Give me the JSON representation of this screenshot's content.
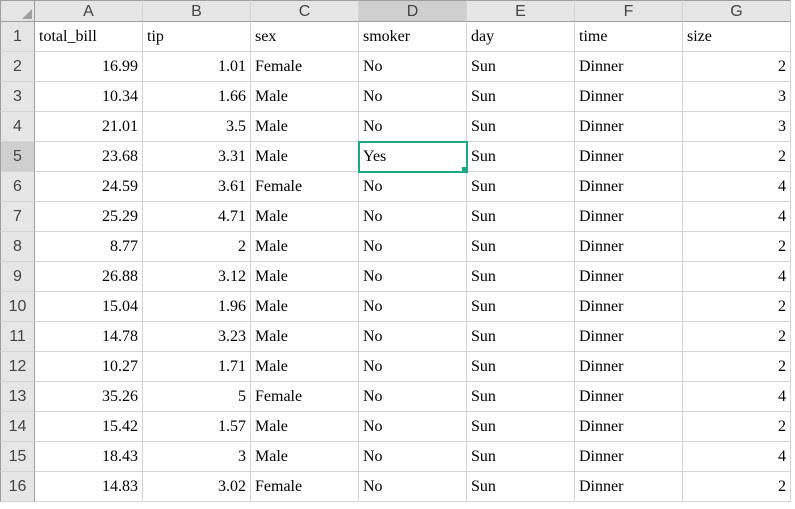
{
  "columns": [
    "A",
    "B",
    "C",
    "D",
    "E",
    "F",
    "G"
  ],
  "selected_col_index": 3,
  "selected_row_index": 4,
  "active_cell": {
    "row": 4,
    "col": 3
  },
  "headers": [
    "total_bill",
    "tip",
    "sex",
    "smoker",
    "day",
    "time",
    "size"
  ],
  "rows": [
    {
      "total_bill": "16.99",
      "tip": "1.01",
      "sex": "Female",
      "smoker": "No",
      "day": "Sun",
      "time": "Dinner",
      "size": "2"
    },
    {
      "total_bill": "10.34",
      "tip": "1.66",
      "sex": "Male",
      "smoker": "No",
      "day": "Sun",
      "time": "Dinner",
      "size": "3"
    },
    {
      "total_bill": "21.01",
      "tip": "3.5",
      "sex": "Male",
      "smoker": "No",
      "day": "Sun",
      "time": "Dinner",
      "size": "3"
    },
    {
      "total_bill": "23.68",
      "tip": "3.31",
      "sex": "Male",
      "smoker": "Yes",
      "day": "Sun",
      "time": "Dinner",
      "size": "2"
    },
    {
      "total_bill": "24.59",
      "tip": "3.61",
      "sex": "Female",
      "smoker": "No",
      "day": "Sun",
      "time": "Dinner",
      "size": "4"
    },
    {
      "total_bill": "25.29",
      "tip": "4.71",
      "sex": "Male",
      "smoker": "No",
      "day": "Sun",
      "time": "Dinner",
      "size": "4"
    },
    {
      "total_bill": "8.77",
      "tip": "2",
      "sex": "Male",
      "smoker": "No",
      "day": "Sun",
      "time": "Dinner",
      "size": "2"
    },
    {
      "total_bill": "26.88",
      "tip": "3.12",
      "sex": "Male",
      "smoker": "No",
      "day": "Sun",
      "time": "Dinner",
      "size": "4"
    },
    {
      "total_bill": "15.04",
      "tip": "1.96",
      "sex": "Male",
      "smoker": "No",
      "day": "Sun",
      "time": "Dinner",
      "size": "2"
    },
    {
      "total_bill": "14.78",
      "tip": "3.23",
      "sex": "Male",
      "smoker": "No",
      "day": "Sun",
      "time": "Dinner",
      "size": "2"
    },
    {
      "total_bill": "10.27",
      "tip": "1.71",
      "sex": "Male",
      "smoker": "No",
      "day": "Sun",
      "time": "Dinner",
      "size": "2"
    },
    {
      "total_bill": "35.26",
      "tip": "5",
      "sex": "Female",
      "smoker": "No",
      "day": "Sun",
      "time": "Dinner",
      "size": "4"
    },
    {
      "total_bill": "15.42",
      "tip": "1.57",
      "sex": "Male",
      "smoker": "No",
      "day": "Sun",
      "time": "Dinner",
      "size": "2"
    },
    {
      "total_bill": "18.43",
      "tip": "3",
      "sex": "Male",
      "smoker": "No",
      "day": "Sun",
      "time": "Dinner",
      "size": "4"
    },
    {
      "total_bill": "14.83",
      "tip": "3.02",
      "sex": "Female",
      "smoker": "No",
      "day": "Sun",
      "time": "Dinner",
      "size": "2"
    }
  ],
  "chart_data": {
    "type": "table",
    "columns": [
      "total_bill",
      "tip",
      "sex",
      "smoker",
      "day",
      "time",
      "size"
    ],
    "data": [
      [
        16.99,
        1.01,
        "Female",
        "No",
        "Sun",
        "Dinner",
        2
      ],
      [
        10.34,
        1.66,
        "Male",
        "No",
        "Sun",
        "Dinner",
        3
      ],
      [
        21.01,
        3.5,
        "Male",
        "No",
        "Sun",
        "Dinner",
        3
      ],
      [
        23.68,
        3.31,
        "Male",
        "Yes",
        "Sun",
        "Dinner",
        2
      ],
      [
        24.59,
        3.61,
        "Female",
        "No",
        "Sun",
        "Dinner",
        4
      ],
      [
        25.29,
        4.71,
        "Male",
        "No",
        "Sun",
        "Dinner",
        4
      ],
      [
        8.77,
        2,
        "Male",
        "No",
        "Sun",
        "Dinner",
        2
      ],
      [
        26.88,
        3.12,
        "Male",
        "No",
        "Sun",
        "Dinner",
        4
      ],
      [
        15.04,
        1.96,
        "Male",
        "No",
        "Sun",
        "Dinner",
        2
      ],
      [
        14.78,
        3.23,
        "Male",
        "No",
        "Sun",
        "Dinner",
        2
      ],
      [
        10.27,
        1.71,
        "Male",
        "No",
        "Sun",
        "Dinner",
        2
      ],
      [
        35.26,
        5,
        "Female",
        "No",
        "Sun",
        "Dinner",
        4
      ],
      [
        15.42,
        1.57,
        "Male",
        "No",
        "Sun",
        "Dinner",
        2
      ],
      [
        18.43,
        3,
        "Male",
        "No",
        "Sun",
        "Dinner",
        4
      ],
      [
        14.83,
        3.02,
        "Female",
        "No",
        "Sun",
        "Dinner",
        2
      ]
    ]
  }
}
